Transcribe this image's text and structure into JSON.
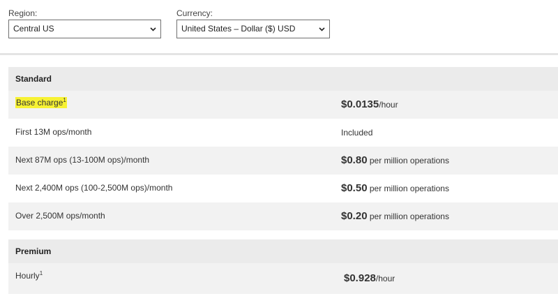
{
  "filters": {
    "region": {
      "label": "Region:",
      "value": "Central US"
    },
    "currency": {
      "label": "Currency:",
      "value": "United States – Dollar ($) USD"
    }
  },
  "standard": {
    "title": "Standard",
    "rows": [
      {
        "label": "Base charge",
        "sup": "1",
        "amount": "$0.0135",
        "unit": "/hour",
        "highlighted": true
      },
      {
        "label": "First 13M ops/month",
        "sup": "",
        "plain": "Included"
      },
      {
        "label": "Next 87M ops (13-100M ops)/month",
        "sup": "",
        "amount": "$0.80",
        "unit": " per million operations"
      },
      {
        "label": "Next 2,400M ops (100-2,500M ops)/month",
        "sup": "",
        "amount": "$0.50",
        "unit": " per million operations"
      },
      {
        "label": "Over 2,500M ops/month",
        "sup": "",
        "amount": "$0.20",
        "unit": " per million operations"
      }
    ]
  },
  "premium": {
    "title": "Premium",
    "rows": [
      {
        "label": "Hourly",
        "sup": "1",
        "amount": "$0.928",
        "unit": "/hour"
      }
    ]
  },
  "colors": {
    "highlight": "#f7f233",
    "row_shade": "#f2f2f2",
    "header_bg": "#ebebeb"
  }
}
